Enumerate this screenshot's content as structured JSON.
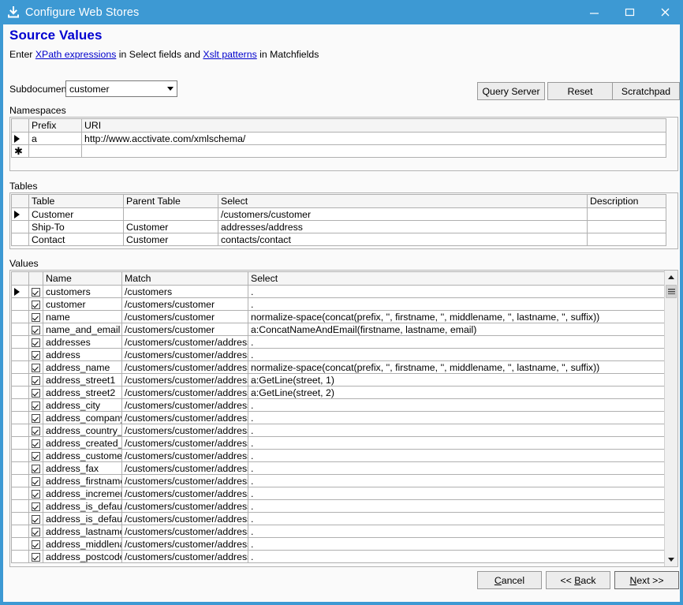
{
  "window": {
    "title": "Configure Web Stores",
    "icon": "install-icon",
    "accent_color": "#3d99d3",
    "caption": {
      "minimize": "–",
      "maximize": "☐",
      "close": "✕"
    }
  },
  "header": {
    "page_title": "Source Values",
    "subtitle_parts": {
      "pre": "Enter ",
      "link1": "XPath expressions",
      "mid": " in Select fields and ",
      "link2": "Xslt patterns",
      "post": " in Matchfields"
    }
  },
  "subdocument": {
    "label": "Subdocument",
    "value": "customer",
    "options": [
      "customer"
    ]
  },
  "toolbar": {
    "query_server": "Query Server",
    "reset": "Reset",
    "scratchpad": "Scratchpad"
  },
  "namespaces": {
    "group_label": "Namespaces",
    "columns": [
      "",
      "Prefix",
      "URI"
    ],
    "rows": [
      {
        "marker": "▶",
        "prefix": "a",
        "uri": "http://www.acctivate.com/xmlschema/"
      },
      {
        "marker": "✱",
        "prefix": "",
        "uri": ""
      }
    ]
  },
  "tables": {
    "group_label": "Tables",
    "columns": [
      "",
      "Table",
      "Parent Table",
      "Select",
      "Description"
    ],
    "rows": [
      {
        "marker": "▶",
        "table": "Customer",
        "parent": "",
        "select": "/customers/customer",
        "description": ""
      },
      {
        "marker": "",
        "table": "Ship-To",
        "parent": "Customer",
        "select": "addresses/address",
        "description": ""
      },
      {
        "marker": "",
        "table": "Contact",
        "parent": "Customer",
        "select": "contacts/contact",
        "description": ""
      }
    ]
  },
  "values": {
    "group_label": "Values",
    "columns": [
      "",
      "",
      "Name",
      "Match",
      "Select"
    ],
    "rows": [
      {
        "marker": "▶",
        "checked": true,
        "name": "customers",
        "match": "/customers",
        "select": "."
      },
      {
        "marker": "",
        "checked": true,
        "name": "customer",
        "match": "/customers/customer",
        "select": "."
      },
      {
        "marker": "",
        "checked": true,
        "name": "name",
        "match": "/customers/customer",
        "select": "normalize-space(concat(prefix, '', firstname, '', middlename, '', lastname, '', suffix))"
      },
      {
        "marker": "",
        "checked": true,
        "name": "name_and_email",
        "match": "/customers/customer",
        "select": "a:ConcatNameAndEmail(firstname, lastname, email)"
      },
      {
        "marker": "",
        "checked": true,
        "name": "addresses",
        "match": "/customers/customer/addresses",
        "select": "."
      },
      {
        "marker": "",
        "checked": true,
        "name": "address",
        "match": "/customers/customer/addresses",
        "select": "."
      },
      {
        "marker": "",
        "checked": true,
        "name": "address_name",
        "match": "/customers/customer/addresses",
        "select": "normalize-space(concat(prefix, '', firstname, '', middlename, '', lastname, '', suffix))"
      },
      {
        "marker": "",
        "checked": true,
        "name": "address_street1",
        "match": "/customers/customer/addresses",
        "select": "a:GetLine(street, 1)"
      },
      {
        "marker": "",
        "checked": true,
        "name": "address_street2",
        "match": "/customers/customer/addresses",
        "select": "a:GetLine(street, 2)"
      },
      {
        "marker": "",
        "checked": true,
        "name": "address_city",
        "match": "/customers/customer/addresses",
        "select": "."
      },
      {
        "marker": "",
        "checked": true,
        "name": "address_company",
        "match": "/customers/customer/addresses",
        "select": "."
      },
      {
        "marker": "",
        "checked": true,
        "name": "address_country_id",
        "match": "/customers/customer/addresses",
        "select": "."
      },
      {
        "marker": "",
        "checked": true,
        "name": "address_created_at",
        "match": "/customers/customer/addresses",
        "select": "."
      },
      {
        "marker": "",
        "checked": true,
        "name": "address_customer_id",
        "match": "/customers/customer/addresses",
        "select": "."
      },
      {
        "marker": "",
        "checked": true,
        "name": "address_fax",
        "match": "/customers/customer/addresses",
        "select": "."
      },
      {
        "marker": "",
        "checked": true,
        "name": "address_firstname",
        "match": "/customers/customer/addresses",
        "select": "."
      },
      {
        "marker": "",
        "checked": true,
        "name": "address_increment",
        "match": "/customers/customer/addresses",
        "select": "."
      },
      {
        "marker": "",
        "checked": true,
        "name": "address_is_default",
        "match": "/customers/customer/addresses",
        "select": "."
      },
      {
        "marker": "",
        "checked": true,
        "name": "address_is_default",
        "match": "/customers/customer/addresses",
        "select": "."
      },
      {
        "marker": "",
        "checked": true,
        "name": "address_lastname",
        "match": "/customers/customer/addresses",
        "select": "."
      },
      {
        "marker": "",
        "checked": true,
        "name": "address_middlename",
        "match": "/customers/customer/addresses",
        "select": "."
      },
      {
        "marker": "",
        "checked": true,
        "name": "address_postcode",
        "match": "/customers/customer/addresses",
        "select": "."
      }
    ]
  },
  "footer": {
    "cancel": "Cancel",
    "cancel_mnemonic": "C",
    "back": "<< Back",
    "back_mnemonic": "B",
    "next": "Next >>",
    "next_mnemonic": "N"
  }
}
